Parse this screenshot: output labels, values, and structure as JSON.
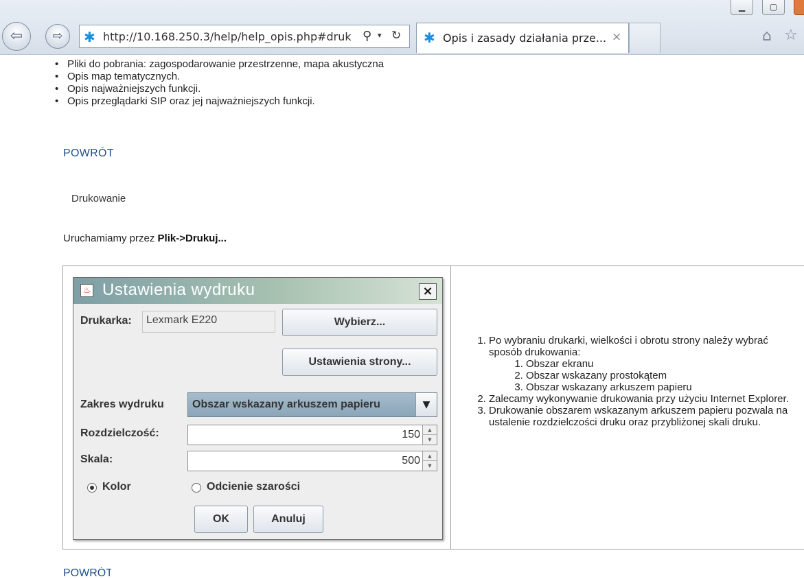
{
  "browser": {
    "address_url": "http://10.168.250.3/help/help_opis.php#druk",
    "tab_title": "Opis i zasady działania prze...",
    "tab_close": "×"
  },
  "page": {
    "features": [
      "Pliki do pobrania: zagospodarowanie przestrzenne, mapa akustyczna",
      "Opis map tematycznych.",
      "Opis najważniejszych funkcji.",
      "Opis przeglądarki SIP oraz jej najważniejszych funkcji."
    ],
    "back_link": "POWRÓT",
    "section_heading": "Drukowanie",
    "intro_prefix": "Uruchamiamy przez ",
    "intro_bold": "Plik->Drukuj...",
    "bottom_link": "POWRÓT"
  },
  "dialog": {
    "title": "Ustawienia wydruku",
    "close": "×",
    "printer_label": "Drukarka:",
    "printer_value": "Lexmark E220",
    "choose_button": "Wybierz...",
    "page_setup_button": "Ustawienia strony...",
    "range_label": "Zakres wydruku",
    "range_value": "Obszar wskazany arkuszem papieru",
    "resolution_label": "Rozdzielczość:",
    "resolution_value": "150",
    "scale_label": "Skala:",
    "scale_value": "500",
    "color_option": "Kolor",
    "gray_option": "Odcienie szarości",
    "ok_button": "OK",
    "cancel_button": "Anuluj"
  },
  "steps": {
    "item1": "Po wybraniu drukarki, wielkości i obrotu strony należy wybrać sposób drukowania:",
    "sub1": "Obszar ekranu",
    "sub2": "Obszar wskazany prostokątem",
    "sub3": "Obszar wskazany arkuszem papieru",
    "item2": "Zalecamy wykonywanie drukowania przy użyciu Internet Explorer.",
    "item3": "Drukowanie obszarem wskazanym arkuszem papieru pozwala na ustalenie rozdzielczości druku oraz przybliżonej skali druku."
  }
}
